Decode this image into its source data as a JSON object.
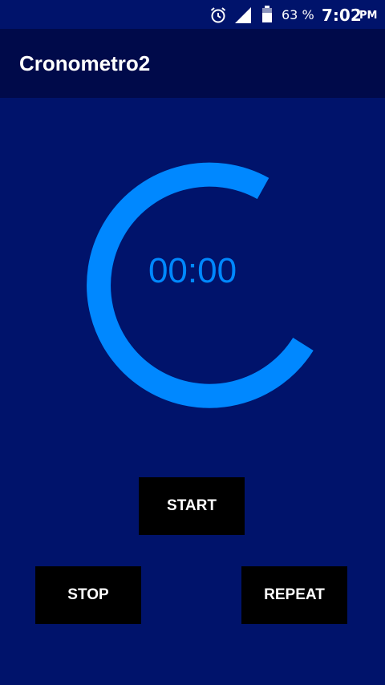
{
  "status_bar": {
    "icons": [
      "alarm-icon",
      "signal-icon",
      "battery-icon"
    ],
    "battery_percent": "63 %",
    "time": "7:02",
    "ampm": "PM"
  },
  "app_bar": {
    "title": "Cronometro2"
  },
  "timer": {
    "display": "00:00",
    "ring_color": "#0088ff"
  },
  "buttons": {
    "start": "START",
    "stop": "STOP",
    "repeat": "REPEAT"
  },
  "colors": {
    "background": "#00136b",
    "app_bar": "#000a4a",
    "accent": "#0088ff",
    "button": "#000000",
    "text": "#ffffff"
  }
}
